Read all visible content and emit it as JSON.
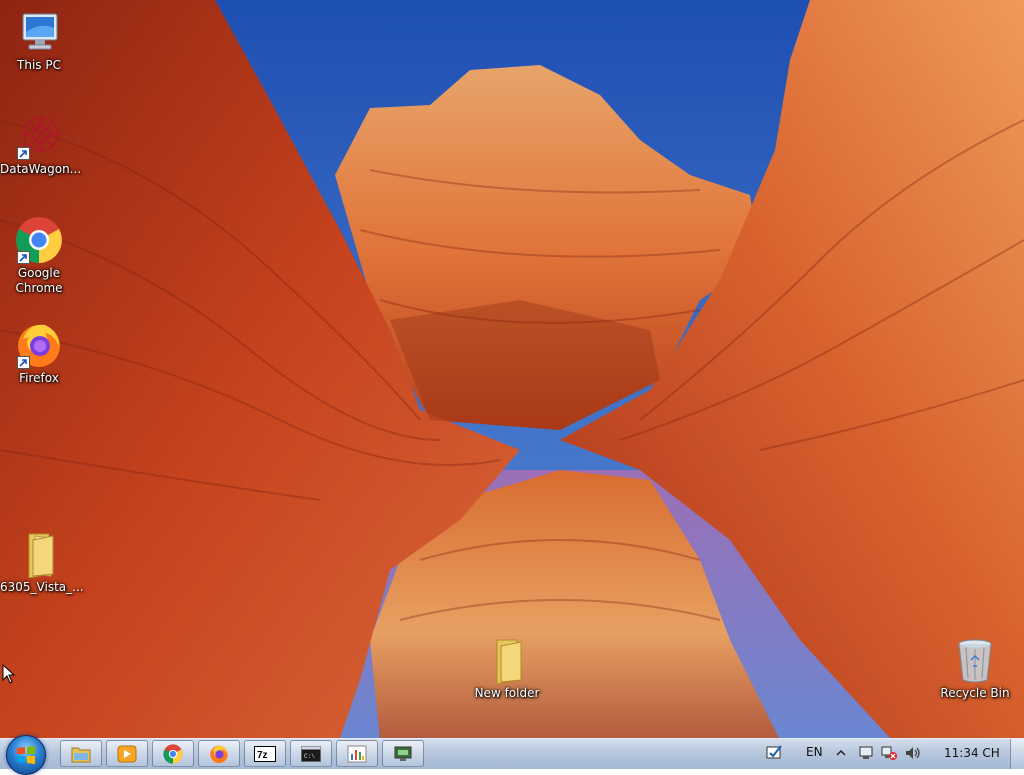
{
  "desktop": {
    "icons": [
      {
        "label": "This PC",
        "icon": "this-pc-icon"
      },
      {
        "label": "DataWagon...",
        "icon": "datawagon-icon"
      },
      {
        "label": "Google Chrome",
        "icon": "chrome-icon"
      },
      {
        "label": "Firefox",
        "icon": "firefox-icon"
      },
      {
        "label": "6305_Vista_...",
        "icon": "folder-icon"
      },
      {
        "label": "New folder",
        "icon": "folder-icon"
      },
      {
        "label": "Recycle Bin",
        "icon": "recycle-bin-icon"
      }
    ]
  },
  "taskbar": {
    "start_icon": "windows-start-orb",
    "pinned": [
      {
        "name": "file-explorer",
        "icon": "folder-icon"
      },
      {
        "name": "media-player",
        "icon": "play-icon"
      },
      {
        "name": "chrome",
        "icon": "chrome-icon"
      },
      {
        "name": "firefox",
        "icon": "firefox-icon"
      },
      {
        "name": "7-zip",
        "icon": "7zip-icon"
      },
      {
        "name": "command-prompt",
        "icon": "cmd-icon"
      },
      {
        "name": "task-manager-chart",
        "icon": "chart-icon"
      },
      {
        "name": "remote-desktop",
        "icon": "monitor-icon"
      }
    ],
    "tray": {
      "language": "EN",
      "clock": "11:34 CH"
    }
  },
  "colors": {
    "taskbar": "#b6c6dc",
    "sky": "#2f66c8",
    "rock": "#c9431e"
  }
}
